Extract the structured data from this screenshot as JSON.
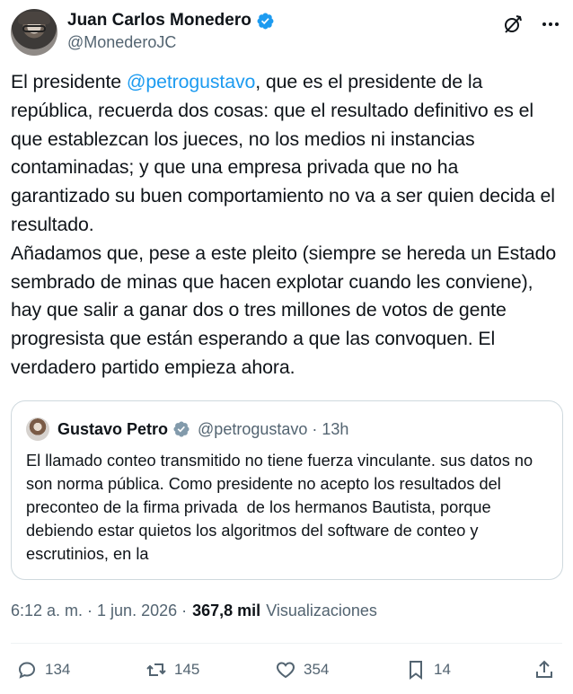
{
  "author": {
    "display_name": "Juan Carlos Monedero",
    "handle": "@MonederoJC"
  },
  "header_icons": [
    "grok-icon",
    "more-icon"
  ],
  "tweet": {
    "text_before_mention": "El presidente ",
    "mention": "@petrogustavo",
    "text_after_mention": ", que es el presidente de la república, recuerda dos cosas: que el resultado definitivo es el que establezcan los jueces, no los medios ni instancias contaminadas; y que una empresa privada que no ha garantizado su buen comportamiento no va a ser quien decida el resultado.\nAñadamos que, pese a este pleito (siempre se hereda un Estado sembrado de minas que hacen explotar cuando les conviene), hay que salir a ganar dos o tres millones de votos de gente progresista que están esperando a que las convoquen. El verdadero partido empieza ahora."
  },
  "quote": {
    "display_name": "Gustavo Petro",
    "handle_time": "@petrogustavo · 13h",
    "text": "El llamado conteo transmitido no tiene fuerza vinculante. sus datos no son norma pública. Como presidente no acepto los resultados del preconteo de la firma privada  de los hermanos Bautista, porque debiendo estar quietos los algoritmos del software de conteo y escrutinios, en la"
  },
  "meta": {
    "timestamp": "6:12 a. m. · 1 jun. 2026 ·",
    "views_count": "367,8 mil",
    "views_label": "Visualizaciones"
  },
  "actions": {
    "replies": "134",
    "reposts": "145",
    "likes": "354",
    "bookmarks": "14"
  },
  "colors": {
    "accent": "#1d9bf0",
    "text": "#0f1419",
    "secondary": "#536471",
    "border": "#cfd9de"
  }
}
